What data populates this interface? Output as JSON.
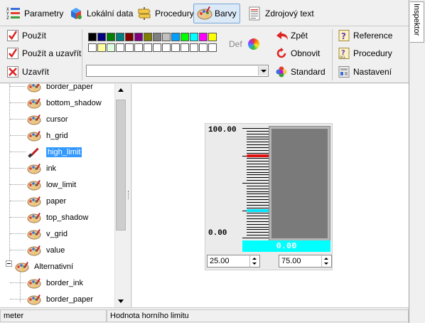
{
  "tabs": [
    {
      "label": "Parametry",
      "icon": "parameters-icon"
    },
    {
      "label": "Lokální data",
      "icon": "local-data-icon"
    },
    {
      "label": "Procedury",
      "icon": "procedures-icon"
    },
    {
      "label": "Barvy",
      "icon": "palette-icon",
      "active": true
    },
    {
      "label": "Zdrojový text",
      "icon": "source-text-icon"
    }
  ],
  "side_tab": {
    "label": "Inspektor"
  },
  "toolbar": {
    "use_label": "Použít",
    "use_close_label": "Použít a uzavřít",
    "close_label": "Uzavřít",
    "def_label": "Def",
    "back_label": "Zpět",
    "refresh_label": "Obnovit",
    "standard_label": "Standard",
    "reference_label": "Reference",
    "procedures_label": "Procedury",
    "settings_label": "Nastavení",
    "colors_row1": [
      "#000000",
      "#000080",
      "#008000",
      "#008080",
      "#800000",
      "#800080",
      "#808000",
      "#808080",
      "#c0c0c0",
      "#00a0ff",
      "#00ff00",
      "#00ffff",
      "#ff00ff",
      "#ffff00"
    ],
    "colors_row2": [
      "#ffffff",
      "#ffffa0",
      "#e0ffe0",
      "#ffffff",
      "#ffffff",
      "#ffffff",
      "#ffffff",
      "#ffffff",
      "#ffffff",
      "#ffffff",
      "#ffffff",
      "#ffffff",
      "#ffffff",
      "#ffffff"
    ],
    "color_select_value": ""
  },
  "tree": {
    "items": [
      "border_paper",
      "bottom_shadow",
      "cursor",
      "h_grid",
      "high_limit",
      "ink",
      "low_limit",
      "paper",
      "top_shadow",
      "v_grid",
      "value"
    ],
    "selected": "high_limit",
    "group_label": "Alternativní",
    "group_items": [
      "border_ink",
      "border_paper"
    ]
  },
  "preview": {
    "scale_max": "100.00",
    "scale_min": "0.00",
    "value_display": "0.00",
    "low_limit_value": "25.00",
    "high_limit_value": "75.00",
    "high_limit_level": 0.75,
    "low_limit_level": 0.25,
    "colors": {
      "high_limit": "#e01010",
      "low_limit": "#00e5ff",
      "value_bg": "#00ffff"
    }
  },
  "status": {
    "left": "meter",
    "right": "Hodnota horního limitu"
  }
}
